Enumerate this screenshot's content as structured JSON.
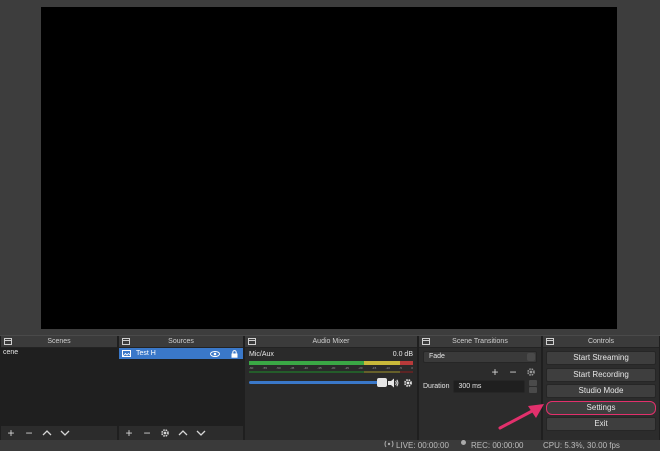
{
  "docks": {
    "scenes": {
      "title": "Scenes",
      "items": [
        {
          "label": "cene",
          "selected": false
        }
      ]
    },
    "sources": {
      "title": "Sources",
      "items": [
        {
          "label": "Test H",
          "selected": true
        }
      ]
    },
    "audio_mixer": {
      "title": "Audio Mixer",
      "channels": [
        {
          "name": "Mic/Aux",
          "level": "0.0 dB",
          "volume_fraction": 0.97
        }
      ],
      "ticks": [
        "-60",
        "-55",
        "-50",
        "-45",
        "-40",
        "-35",
        "-30",
        "-25",
        "-20",
        "-15",
        "-10",
        "-5",
        "0"
      ]
    },
    "scene_transitions": {
      "title": "Scene Transitions",
      "transition": "Fade",
      "duration_label": "Duration",
      "duration_value": "300 ms"
    },
    "controls": {
      "title": "Controls",
      "start_streaming": "Start Streaming",
      "start_recording": "Start Recording",
      "studio_mode": "Studio Mode",
      "settings": "Settings",
      "exit": "Exit"
    }
  },
  "statusbar": {
    "live": "LIVE: 00:00:00",
    "rec": "REC: 00:00:00",
    "cpu": "CPU: 5.3%, 30.00 fps"
  },
  "colors": {
    "selection": "#3a78c9",
    "highlight": "#e2306c",
    "preview": "#000000"
  }
}
